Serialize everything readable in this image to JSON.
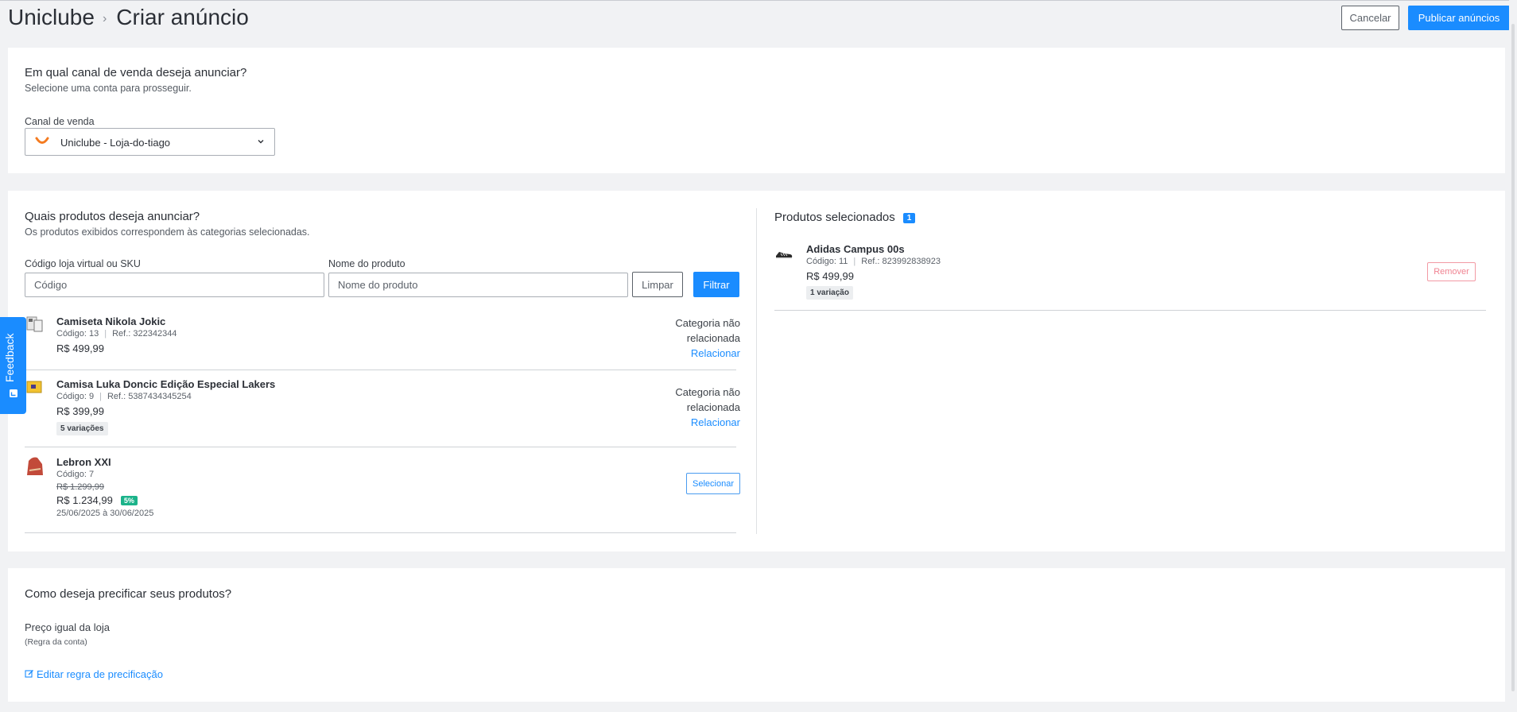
{
  "header": {
    "app_title": "Uniclube",
    "separator": "›",
    "page_title": "Criar anúncio",
    "cancel_label": "Cancelar",
    "publish_label": "Publicar anúncios"
  },
  "channel_section": {
    "title": "Em qual canal de venda deseja anunciar?",
    "subtitle": "Selecione uma conta para prosseguir.",
    "field_label": "Canal de venda",
    "selected_value": "Uniclube - Loja-do-tiago",
    "logo_icon": "uniclube-logo-icon",
    "logo_color": "#f47b20"
  },
  "products_section": {
    "title": "Quais produtos deseja anunciar?",
    "subtitle": "Os produtos exibidos correspondem às categorias selecionadas.",
    "sku_label": "Código loja virtual ou SKU",
    "sku_placeholder": "Código",
    "name_label": "Nome do produto",
    "name_placeholder": "Nome do produto",
    "clear_label": "Limpar",
    "filter_label": "Filtrar",
    "items": [
      {
        "name": "Camiseta Nikola Jokic",
        "code": "Código: 13",
        "ref": "Ref.: 322342344",
        "price": "R$ 499,99",
        "category_status_1": "Categoria não",
        "category_status_2": "relacionada",
        "relate_label": "Relacionar"
      },
      {
        "name": "Camisa Luka Doncic Edição Especial Lakers",
        "code": "Código: 9",
        "ref": "Ref.: 5387434345254",
        "price": "R$ 399,99",
        "variations": "5 variações",
        "category_status_1": "Categoria não",
        "category_status_2": "relacionada",
        "relate_label": "Relacionar"
      },
      {
        "name": "Lebron XXI",
        "code": "Código: 7",
        "old_price": "R$ 1.299,99",
        "price": "R$ 1.234,99",
        "discount": "5%",
        "dates": "25/06/2025 à 30/06/2025",
        "select_label": "Selecionar"
      }
    ]
  },
  "selected_section": {
    "title": "Produtos selecionados",
    "count": "1",
    "items": [
      {
        "name": "Adidas Campus 00s",
        "code": "Código: 11",
        "ref": "Ref.: 823992838923",
        "price": "R$ 499,99",
        "variations": "1 variação",
        "remove_label": "Remover"
      }
    ]
  },
  "pricing_section": {
    "title": "Como deseja precificar seus produtos?",
    "rule_label": "Preço igual da loja",
    "rule_note": "(Regra da conta)",
    "edit_label": "Editar regra de precificação"
  },
  "feedback": {
    "label": "Feedback"
  },
  "colors": {
    "primary": "#1a8cff",
    "danger": "#f08391",
    "success": "#1bb38a",
    "background": "#f1f2f4"
  }
}
